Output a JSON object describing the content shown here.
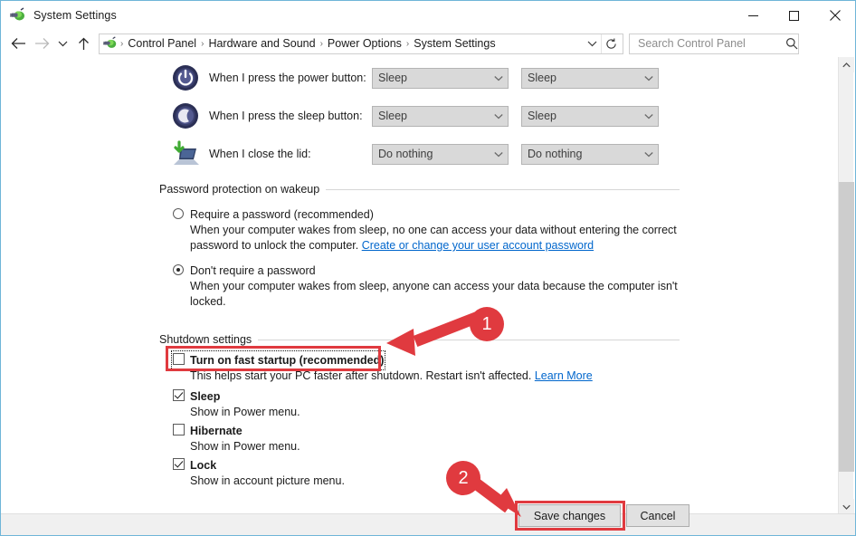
{
  "window": {
    "title": "System Settings",
    "title_icon": "power-plug-icon",
    "controls": {
      "minimize": "minimize-button",
      "maximize": "maximize-button",
      "close": "close-button"
    }
  },
  "navbar": {
    "back": "back-button",
    "forward": "forward-button",
    "recent": "recent-locations-button",
    "up": "up-button",
    "breadcrumbs": [
      "Control Panel",
      "Hardware and Sound",
      "Power Options",
      "System Settings"
    ],
    "separator": "›",
    "dropdown_icon": "chevron-down-icon",
    "refresh_icon": "refresh-icon"
  },
  "search": {
    "placeholder": "Search Control Panel",
    "value": "",
    "icon": "search-icon"
  },
  "settings_rows": [
    {
      "icon": "power-button-icon",
      "label": "When I press the power button:",
      "battery_value": "Sleep",
      "plugged_value": "Sleep"
    },
    {
      "icon": "sleep-moon-icon",
      "label": "When I press the sleep button:",
      "battery_value": "Sleep",
      "plugged_value": "Sleep"
    },
    {
      "icon": "laptop-lid-icon",
      "label": "When I close the lid:",
      "battery_value": "Do nothing",
      "plugged_value": "Do nothing"
    }
  ],
  "password_section": {
    "heading": "Password protection on wakeup",
    "options": [
      {
        "label": "Require a password (recommended)",
        "checked": false,
        "description": "When your computer wakes from sleep, no one can access your data without entering the correct password to unlock the computer.",
        "link": "Create or change your user account password"
      },
      {
        "label": "Don't require a password",
        "checked": true,
        "description": "When your computer wakes from sleep, anyone can access your data because the computer isn't locked.",
        "link": ""
      }
    ]
  },
  "shutdown_section": {
    "heading": "Shutdown settings",
    "items": [
      {
        "label": "Turn on fast startup (recommended)",
        "checked": false,
        "description": "This helps start your PC faster after shutdown. Restart isn't affected.",
        "link": "Learn More"
      },
      {
        "label": "Sleep",
        "checked": true,
        "description": "Show in Power menu.",
        "link": ""
      },
      {
        "label": "Hibernate",
        "checked": false,
        "description": "Show in Power menu.",
        "link": ""
      },
      {
        "label": "Lock",
        "checked": true,
        "description": "Show in account picture menu.",
        "link": ""
      }
    ]
  },
  "footer": {
    "save_label": "Save changes",
    "cancel_label": "Cancel"
  },
  "annotations": {
    "color": "#e03a3f",
    "badges": [
      {
        "number": "1",
        "target": "Turn on fast startup (recommended)"
      },
      {
        "number": "2",
        "target": "Save changes"
      }
    ]
  },
  "scrollbar": {
    "up_icon": "chevron-up-icon",
    "down_icon": "chevron-down-icon"
  }
}
